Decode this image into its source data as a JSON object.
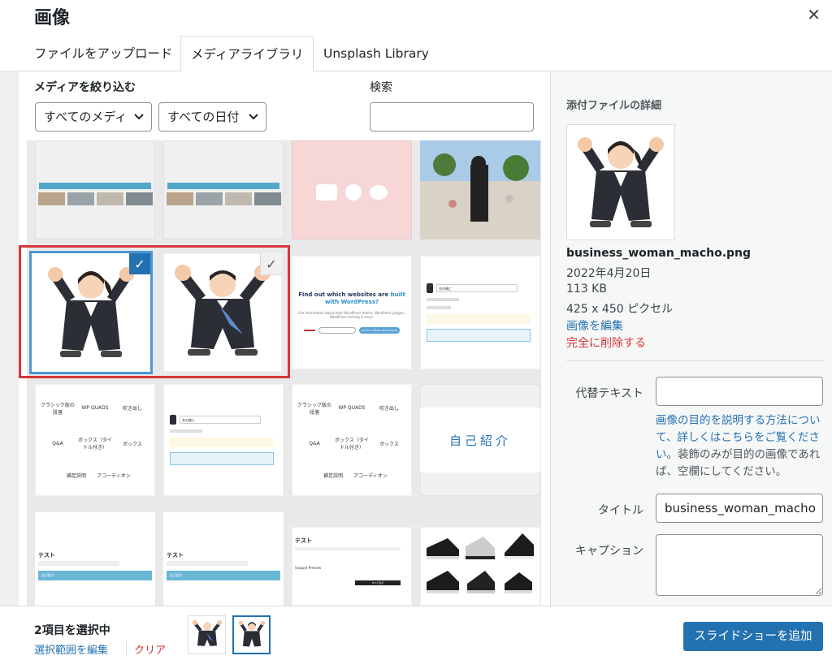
{
  "header": {
    "title": "画像"
  },
  "tabs": [
    {
      "label": "ファイルをアップロード"
    },
    {
      "label": "メディアライブラリ"
    },
    {
      "label": "Unsplash Library"
    }
  ],
  "filters": {
    "label": "メディアを絞り込む",
    "media_type": "すべてのメディ",
    "dates": "すべての日付",
    "search_label": "検索",
    "search_value": ""
  },
  "grid": {
    "thumbs": [
      {
        "label": "screenshot-1"
      },
      {
        "label": "screenshot-2"
      },
      {
        "label": "speech-bubbles"
      },
      {
        "label": "fountain-photo"
      },
      {
        "label": "business-woman"
      },
      {
        "label": "business-man"
      },
      {
        "title": "Find out which websites are",
        "title_accent": "built with WordPress?",
        "sub": "Get information about their WordPress theme, WordPress plugins, WordPress hosting & more.",
        "btn": "DETECT THEME AND PLUGINS"
      },
      {
        "name": "名の後に"
      },
      {
        "items": [
          "クラシック版の段落",
          "WP QUADS",
          "吹き出し",
          "Q&A",
          "ボックス（タイトル付き）",
          "ボックス",
          "補足説明",
          "アコーディオン"
        ]
      },
      {
        "name": "名の後に"
      },
      {
        "items": [
          "クラシック版の段落",
          "WP QUADS",
          "吹き出し",
          "Q&A",
          "ボックス（タイトル付き）",
          "ボックス",
          "補足説明",
          "アコーディオン"
        ]
      },
      {
        "text": "自己紹介"
      },
      {
        "title": "テスト",
        "bar": "自己紹介"
      },
      {
        "title": "テスト",
        "bar": "自己紹介"
      },
      {
        "title": "テスト",
        "block": "Snippet Preview",
        "footer": "すべて表示"
      },
      {
        "label": "sneakers"
      }
    ]
  },
  "sidebar": {
    "title": "添付ファイルの詳細",
    "filename": "business_woman_macho.png",
    "date": "2022年4月20日",
    "size": "113 KB",
    "dimensions": "425 x 450 ピクセル",
    "edit_link": "画像を編集",
    "delete_link": "完全に削除する",
    "alt_label": "代替テキスト",
    "alt_value": "",
    "alt_help_link": "画像の目的を説明する方法について、詳しくはこちらをご覧ください",
    "alt_help_rest": "。装飾のみが目的の画像であれば、空欄にしてください。",
    "title_label": "タイトル",
    "title_value": "business_woman_macho",
    "caption_label": "キャプション",
    "caption_value": ""
  },
  "footer": {
    "count": "2項目を選択中",
    "edit_selection": "選択範囲を編集",
    "clear": "クリア",
    "primary": "スライドショーを追加"
  },
  "colors": {
    "accent": "#2271b1",
    "danger": "#d63638"
  }
}
